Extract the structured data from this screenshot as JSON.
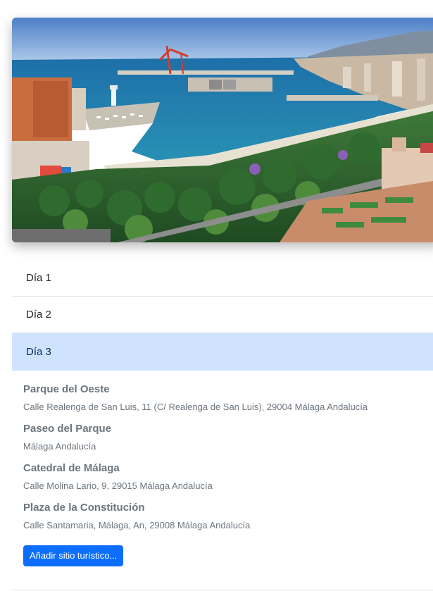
{
  "accordion": {
    "days": [
      {
        "label": "Día 1"
      },
      {
        "label": "Día 2"
      },
      {
        "label": "Día 3"
      }
    ],
    "active_day": 3
  },
  "sites": [
    {
      "name": "Parque del Oeste",
      "address": "Calle Realenga de San Luis, 11 (C/ Realenga de San Luis), 29004 Málaga Andalucía"
    },
    {
      "name": "Paseo del Parque",
      "address": "Málaga Andalucía"
    },
    {
      "name": "Catedral de Málaga",
      "address": "Calle Molina Lario, 9, 29015 Málaga Andalucía"
    },
    {
      "name": "Plaza de la Constitución",
      "address": "Calle Santamaria, Málaga, An, 29008 Málaga Andalucía"
    }
  ],
  "actions": {
    "add_site_label": "Añadir sitio turístico..."
  },
  "colors": {
    "active_header_bg": "#cfe2ff",
    "primary_button": "#0d6efd",
    "muted_text": "#6c757d"
  }
}
